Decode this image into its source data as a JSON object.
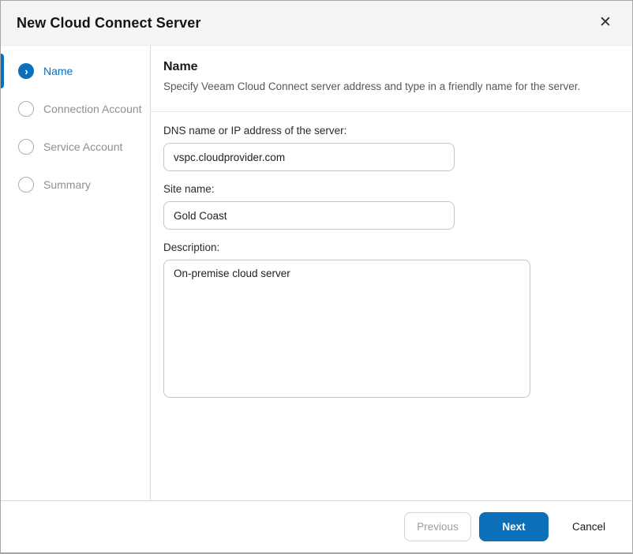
{
  "dialog": {
    "title": "New Cloud Connect Server",
    "close_icon": "✕"
  },
  "sidebar": {
    "steps": [
      {
        "label": "Name",
        "state": "active"
      },
      {
        "label": "Connection Account",
        "state": "pending"
      },
      {
        "label": "Service Account",
        "state": "pending"
      },
      {
        "label": "Summary",
        "state": "pending"
      }
    ],
    "active_chevron_icon": "›"
  },
  "content": {
    "heading": "Name",
    "subtitle": "Specify Veeam Cloud Connect server address and type in a friendly name for the server.",
    "fields": {
      "dns": {
        "label": "DNS name or IP address of the server:",
        "value": "vspc.cloudprovider.com"
      },
      "site": {
        "label": "Site name:",
        "value": "Gold Coast"
      },
      "description": {
        "label": "Description:",
        "value": "On-premise cloud server"
      }
    }
  },
  "footer": {
    "previous_label": "Previous",
    "next_label": "Next",
    "cancel_label": "Cancel"
  },
  "colors": {
    "accent_blue": "#0b70b9",
    "titlebar_bg": "#f5f5f6",
    "inactive_gray": "#8e9093"
  }
}
